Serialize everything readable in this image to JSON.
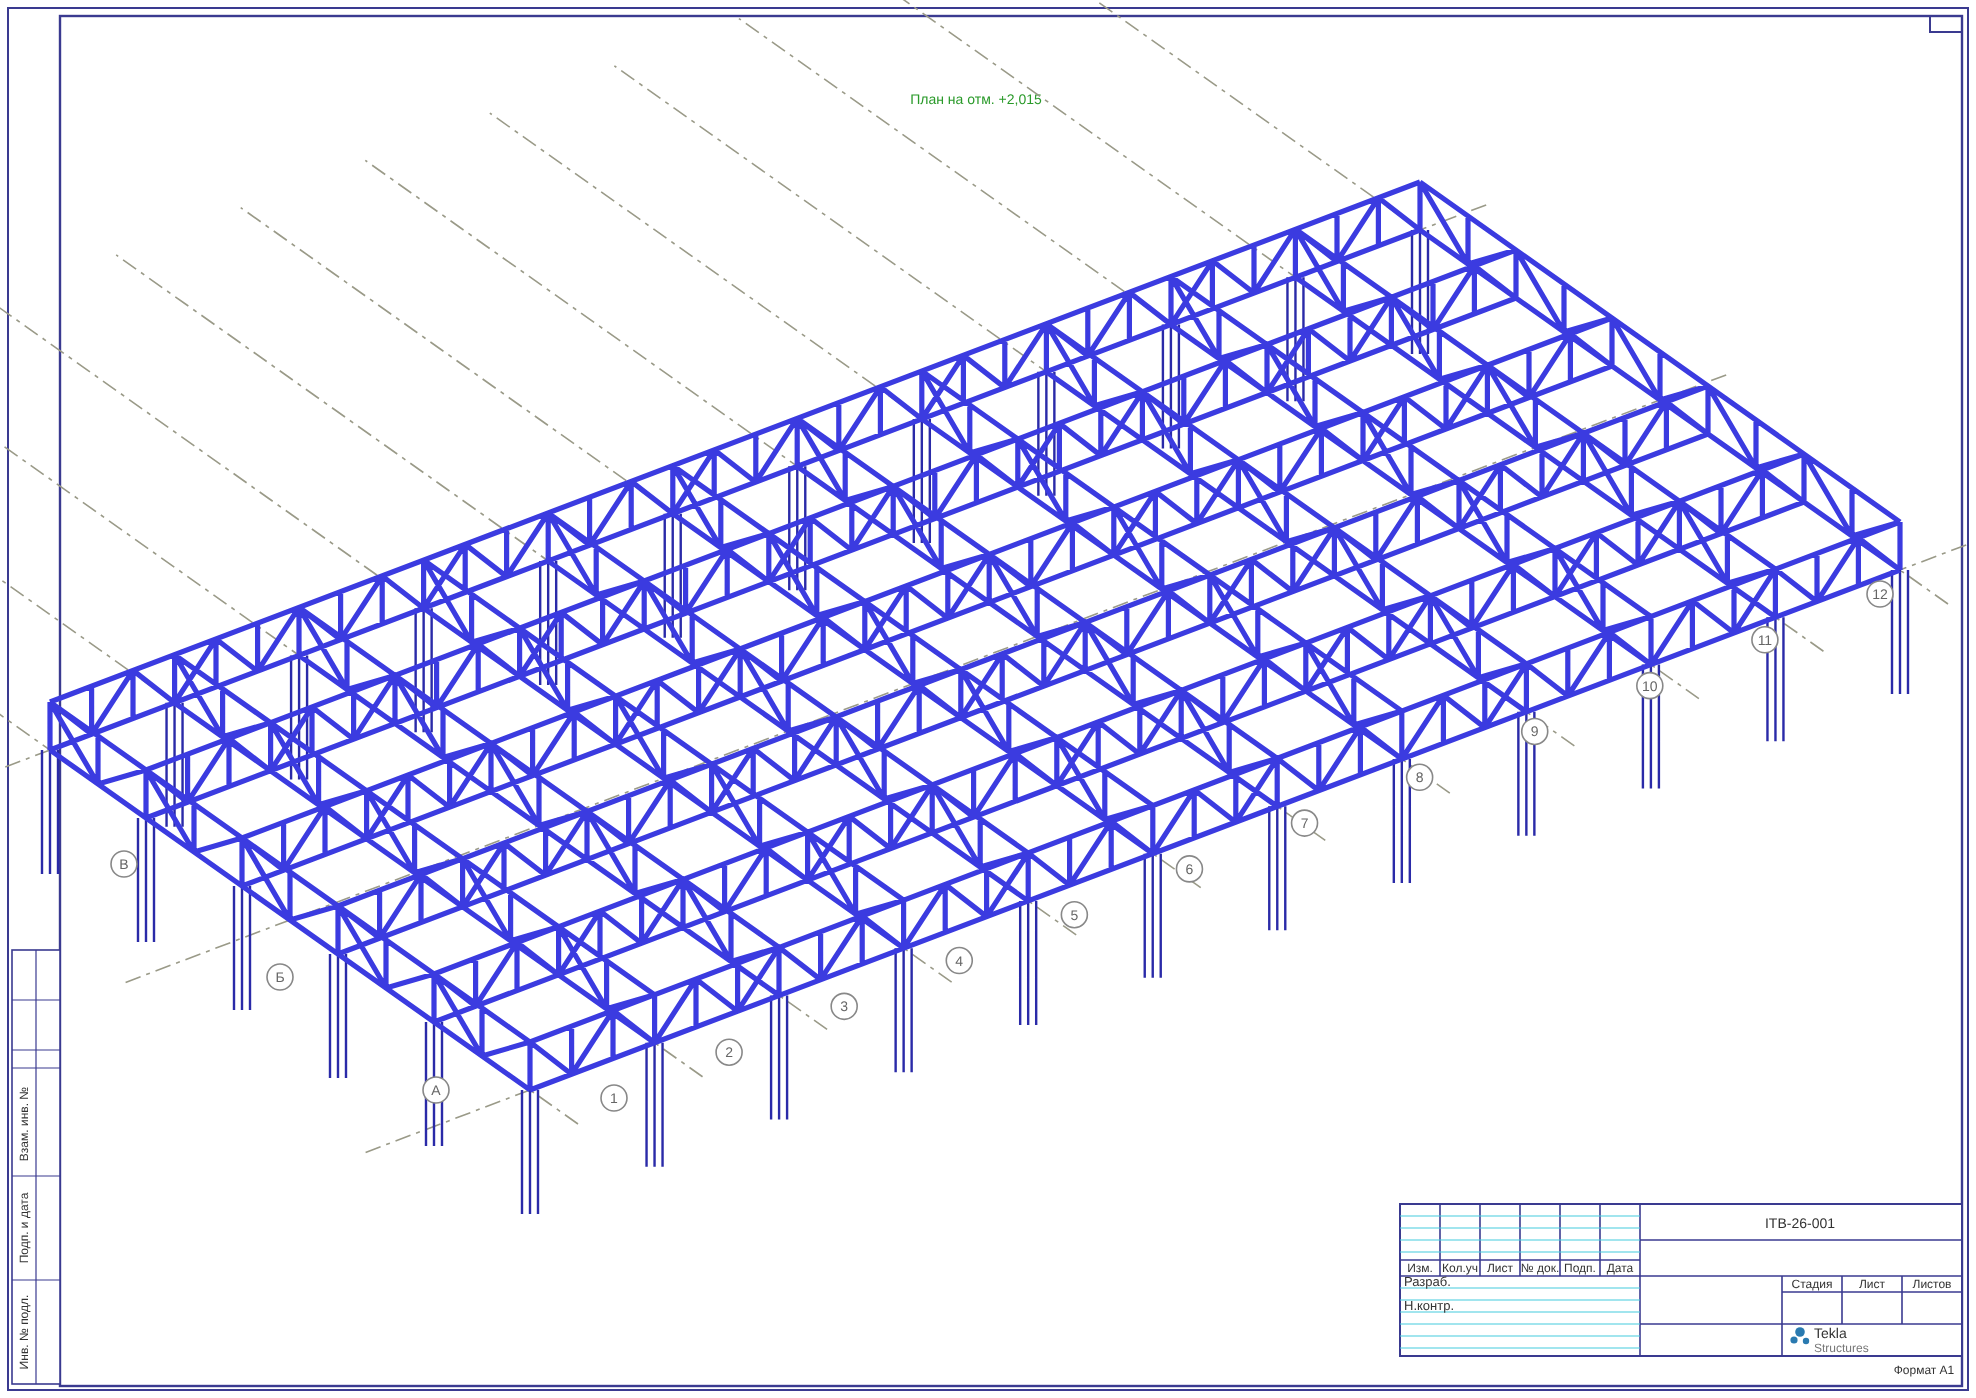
{
  "title": "План на отм. +2,015",
  "row_axes": [
    "А",
    "Б",
    "В"
  ],
  "column_axes": [
    "1",
    "2",
    "3",
    "4",
    "5",
    "6",
    "7",
    "8",
    "9",
    "10",
    "11",
    "12"
  ],
  "title_block": {
    "designation": "ITB-26-001",
    "change_headers": [
      "Изм.",
      "Кол.уч",
      "Лист",
      "№ док.",
      "Подп.",
      "Дата"
    ],
    "roles": [
      "Разраб.",
      "Н.контр."
    ],
    "sheet_headers": [
      "Стадия",
      "Лист",
      "Листов"
    ],
    "logo": [
      "Tekla",
      "Structures"
    ],
    "format": "Формат А1"
  },
  "side_stamp": [
    "Взам. инв. №",
    "Подп. и дата",
    "Инв. № подл."
  ]
}
